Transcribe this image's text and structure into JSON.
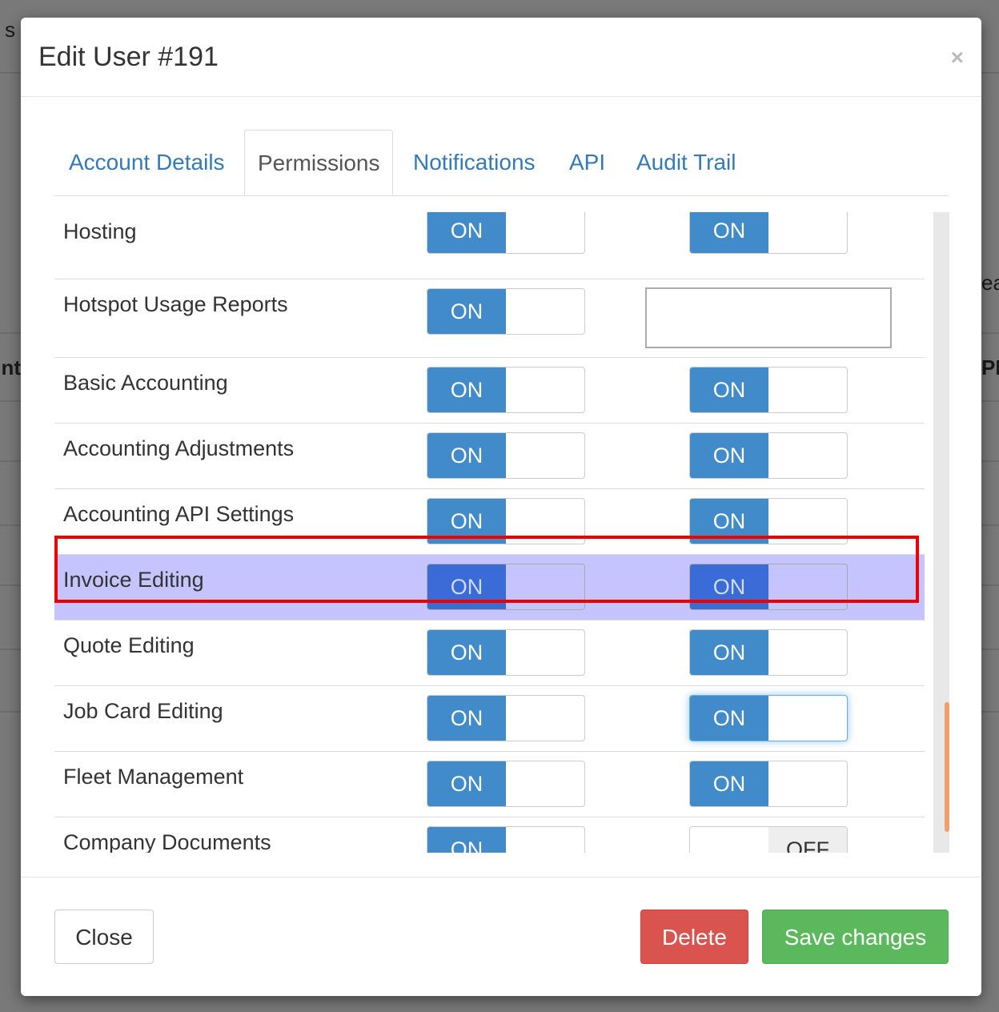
{
  "background": {
    "fragments": [
      "s",
      "ea",
      "nt",
      "PE"
    ]
  },
  "modal": {
    "title": "Edit User #191",
    "close_symbol": "×"
  },
  "tabs": [
    {
      "label": "Account Details",
      "active": false
    },
    {
      "label": "Permissions",
      "active": true
    },
    {
      "label": "Notifications",
      "active": false
    },
    {
      "label": "API",
      "active": false
    },
    {
      "label": "Audit Trail",
      "active": false
    }
  ],
  "permissions": [
    {
      "label": "Hosting",
      "col1": "ON",
      "col2": "ON"
    },
    {
      "label": "Hotspot Usage Reports",
      "col1": "ON",
      "col2": ""
    },
    {
      "label": "Basic Accounting",
      "col1": "ON",
      "col2": "ON"
    },
    {
      "label": "Accounting Adjustments",
      "col1": "ON",
      "col2": "ON"
    },
    {
      "label": "Accounting API Settings",
      "col1": "ON",
      "col2": "ON"
    },
    {
      "label": "Invoice Editing",
      "col1": "ON",
      "col2": "ON",
      "highlighted": true
    },
    {
      "label": "Quote Editing",
      "col1": "ON",
      "col2": "ON"
    },
    {
      "label": "Job Card Editing",
      "col1": "ON",
      "col2": "ON"
    },
    {
      "label": "Fleet Management",
      "col1": "ON",
      "col2": "ON"
    },
    {
      "label": "Company Documents",
      "col1": "ON",
      "col2": "OFF"
    }
  ],
  "footer": {
    "close_label": "Close",
    "delete_label": "Delete",
    "save_label": "Save changes"
  },
  "colors": {
    "primary": "#428bca",
    "danger": "#d9534f",
    "success": "#5cb85c",
    "highlight": "#c6c4ff",
    "outline": "#ee0000"
  }
}
